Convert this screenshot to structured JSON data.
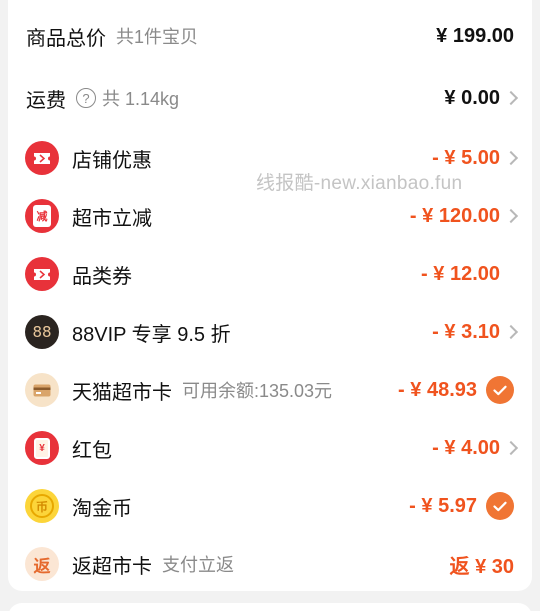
{
  "total": {
    "label": "商品总价",
    "sub": "共1件宝贝",
    "value": "¥ 199.00"
  },
  "shipping": {
    "label": "运费",
    "help_glyph": "?",
    "sub": "共 1.14kg",
    "value": "¥ 0.00"
  },
  "rows": [
    {
      "icon": "ticket-icon",
      "label": "店铺优惠",
      "value": "- ¥ 5.00"
    },
    {
      "icon": "discount-tag-icon",
      "icon_text": "减",
      "label": "超市立减",
      "value": "- ¥ 120.00"
    },
    {
      "icon": "ticket-icon",
      "label": "品类券",
      "value": "- ¥ 12.00"
    },
    {
      "icon": "vip88-icon",
      "icon_text": "88",
      "label": "88VIP 专享 9.5 折",
      "value": "- ¥ 3.10"
    },
    {
      "icon": "card-icon",
      "label": "天猫超市卡",
      "sub": "可用余额:135.03元",
      "value": "- ¥ 48.93"
    },
    {
      "icon": "red-envelope-icon",
      "icon_text": "¥",
      "label": "红包",
      "value": "- ¥ 4.00"
    },
    {
      "icon": "coin-icon",
      "icon_text": "币",
      "label": "淘金币",
      "value": "- ¥ 5.97"
    },
    {
      "icon": "rebate-icon",
      "icon_text": "返",
      "label": "返超市卡",
      "sub": "支付立返",
      "value": "返 ¥ 30"
    }
  ],
  "watermark": "线报酷-new.xianbao.fun",
  "colors": {
    "accent": "#f0531e",
    "check": "#f07534",
    "red_icon": "#e8323a"
  }
}
